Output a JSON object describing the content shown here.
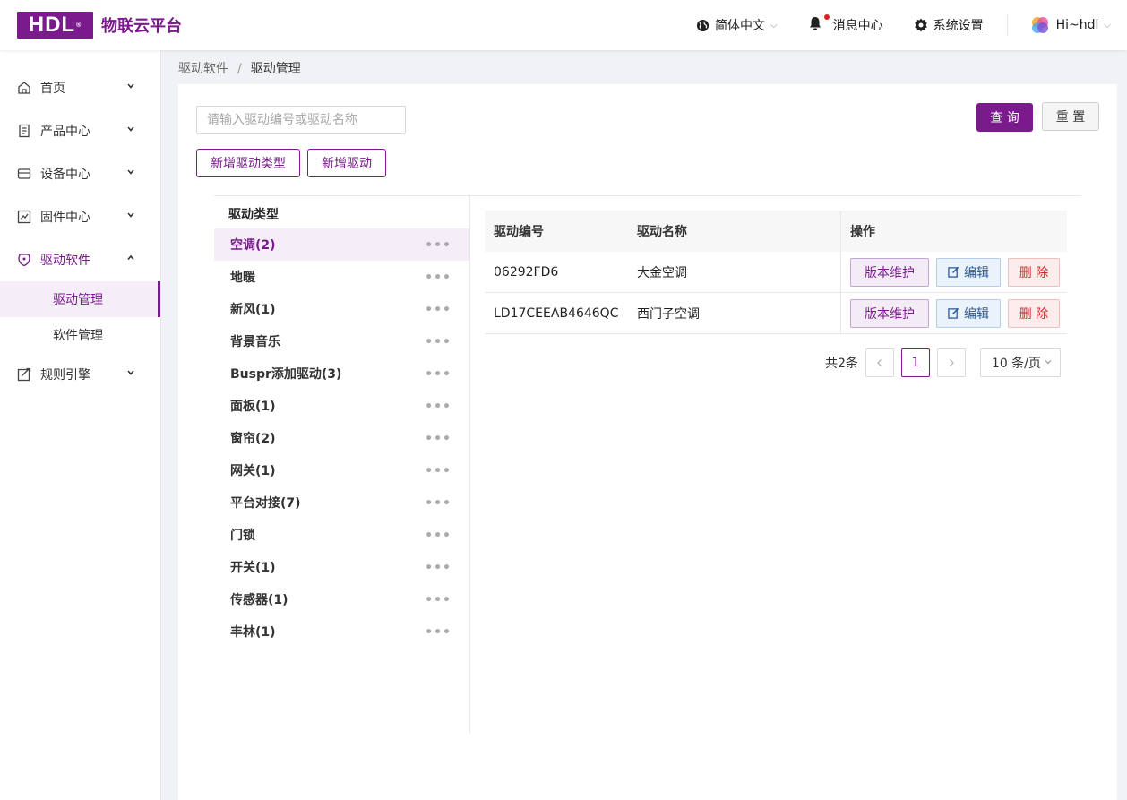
{
  "header": {
    "logo": "HDL",
    "brand": "物联云平台",
    "language": "简体中文",
    "messages": "消息中心",
    "settings": "系统设置",
    "user": "Hi~hdl"
  },
  "sidebar": {
    "items": [
      {
        "label": "首页",
        "icon": "home-icon"
      },
      {
        "label": "产品中心",
        "icon": "product-icon"
      },
      {
        "label": "设备中心",
        "icon": "device-icon"
      },
      {
        "label": "固件中心",
        "icon": "firmware-icon"
      },
      {
        "label": "驱动软件",
        "icon": "driver-icon"
      },
      {
        "label": "规则引擎",
        "icon": "rule-icon"
      }
    ],
    "sub": [
      "驱动管理",
      "软件管理"
    ]
  },
  "breadcrumb": {
    "parent": "驱动软件",
    "separator": "/",
    "current": "驱动管理"
  },
  "toolbar": {
    "search_placeholder": "请输入驱动编号或驱动名称",
    "query": "查 询",
    "reset": "重 置",
    "add_type": "新增驱动类型",
    "add_driver": "新增驱动"
  },
  "tree": {
    "title": "驱动类型",
    "nodes": [
      "空调(2)",
      "地暖",
      "新风(1)",
      "背景音乐",
      "Buspr添加驱动(3)",
      "面板(1)",
      "窗帘(2)",
      "网关(1)",
      "平台对接(7)",
      "门锁",
      "开关(1)",
      "传感器(1)",
      "丰林(1)"
    ]
  },
  "table": {
    "headers": [
      "驱动编号",
      "驱动名称",
      "操作"
    ],
    "rows": [
      {
        "code": "06292FD6",
        "name": "大金空调"
      },
      {
        "code": "LD17CEEAB4646QC",
        "name": "西门子空调"
      }
    ],
    "actions": {
      "version": "版本维护",
      "edit": "编辑",
      "delete": "删 除"
    }
  },
  "pagination": {
    "total": "共2条",
    "current": "1",
    "page_size": "10 条/页"
  },
  "colors": {
    "accent": "#7a1a8c"
  }
}
